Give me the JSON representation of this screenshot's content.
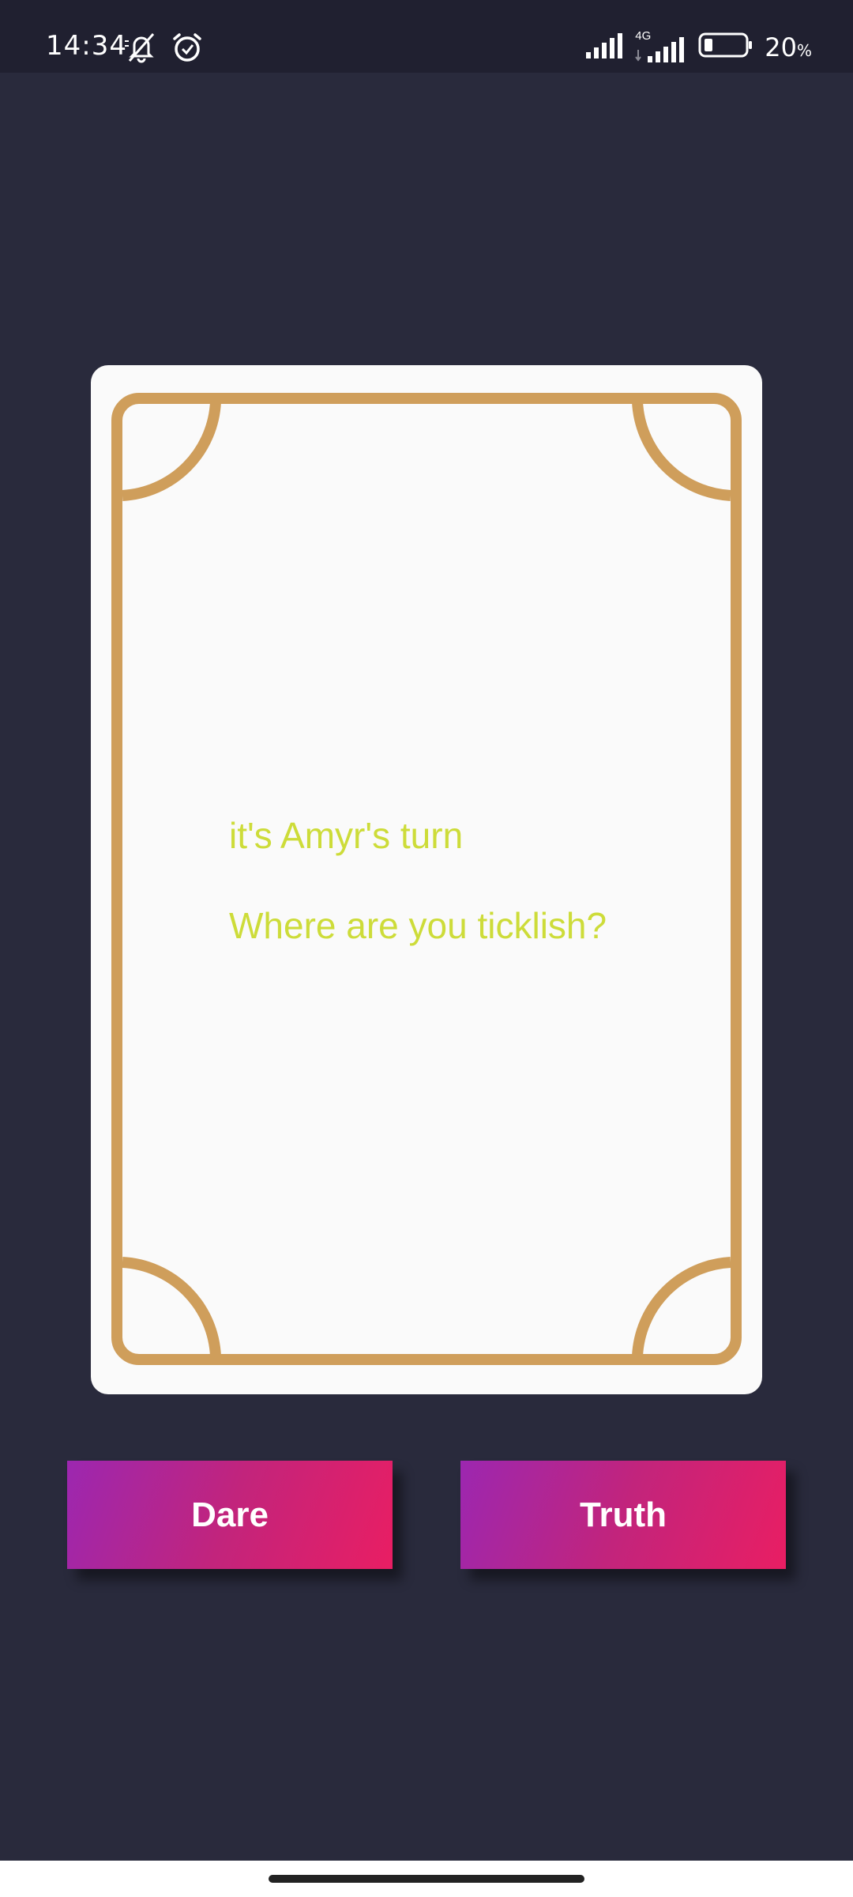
{
  "status_bar": {
    "time": "14:34",
    "network_label": "4G",
    "battery_level": "20",
    "battery_unit": "%",
    "icons": [
      "silent-bell-icon",
      "alarm-icon",
      "signal-icon",
      "signal-4g-icon",
      "battery-icon"
    ]
  },
  "card": {
    "turn_text": "it's Amyr's turn",
    "question_text": "Where are you ticklish?",
    "text_color": "#cddc39",
    "frame_color": "#cf9e5b"
  },
  "buttons": {
    "dare_label": "Dare",
    "truth_label": "Truth",
    "gradient_start": "#9c27b0",
    "gradient_end": "#e91e63"
  },
  "theme": {
    "background": "#292a3c",
    "status_bar_bg": "#202030"
  }
}
